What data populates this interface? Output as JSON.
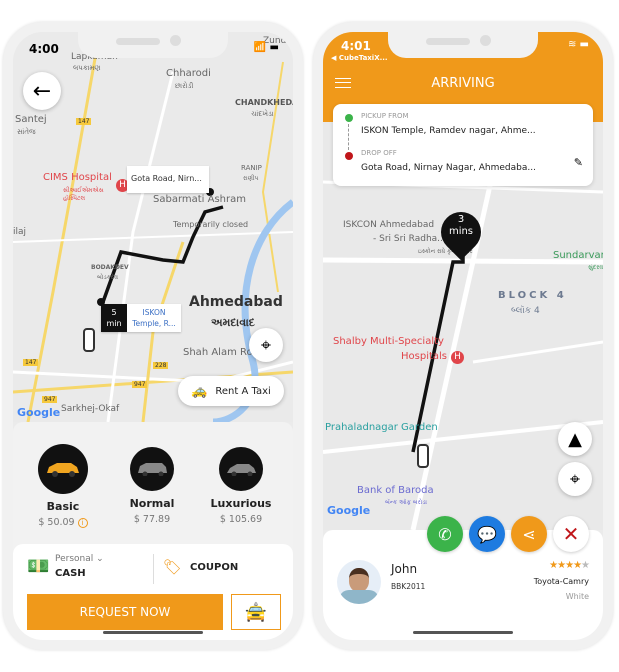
{
  "colors": {
    "accent": "#f0991a",
    "green": "#3bb34a",
    "blue": "#1e7be0",
    "red": "#c0161a"
  },
  "left": {
    "status_time": "4:00",
    "map_labels": {
      "lapkaman": "Lapkaman",
      "lapkaman_gu": "લપકામણ",
      "chharodi": "Chharodi",
      "chharodi_gu": "છારોડી",
      "chandkheda": "CHANDKHEDA",
      "chandkheda_gu": "ચાંદખેડા",
      "santej": "Santej",
      "santej_gu": "સાંતેજ",
      "zundal": "Zundal",
      "cims": "CIMS Hospital",
      "cims_gu": "સીઆઈએમએસ હૉસ્પિટલ",
      "ranip": "RANIP",
      "ranip_gu": "રાણીપ",
      "sabarmati": "Sabarmati Ashram",
      "temp_closed": "Temporarily closed",
      "bodakdev": "BODAKDEV",
      "bodakdev_gu": "બોડકદેવ",
      "ilaj": "ilaj",
      "ahmedabad": "Ahmedabad",
      "ahmedabad_gu": "અમદાવાદ",
      "shah_alam": "Shah Alam Roza",
      "sarkhej": "Sarkhej-Okaf",
      "r147a": "147",
      "r147b": "147",
      "r228": "228",
      "r947a": "947",
      "r947b": "947",
      "google": "Google"
    },
    "drop_tooltip": "Gota Road, Nirn...",
    "eta_value": "5",
    "eta_unit": "min",
    "pickup_tooltip": "ISKON Temple, R...",
    "rent_taxi": "Rent A Taxi",
    "vehicles": [
      {
        "name": "Basic",
        "price": "$ 50.09",
        "selected": true
      },
      {
        "name": "Normal",
        "price": "$ 77.89"
      },
      {
        "name": "Luxurious",
        "price": "$ 105.69"
      }
    ],
    "payment": {
      "type": "Personal",
      "method": "CASH"
    },
    "coupon": "COUPON",
    "request": "REQUEST NOW"
  },
  "right": {
    "status_time": "4:01",
    "back_app": "◀ CubeTaxiX...",
    "title": "ARRIVING",
    "pickup_label": "PICKUP FROM",
    "pickup": "ISKON Temple, Ramdev nagar, Ahme...",
    "drop_label": "DROP OFF",
    "drop": "Gota Road, Nirnay Nagar, Ahmedaba...",
    "eta_value": "3",
    "eta_unit": "mins",
    "map_labels": {
      "iskcon": "ISKCON Ahmedabad",
      "iskcon2": "- Sri Sri Radha...",
      "iskcon_gu": "ઇસ્કોન રાધે કૃષ્ણ મંદિર",
      "sundarvan": "Sundarvan",
      "sundarvan_gu": "સુંદરવ",
      "block4": "BLOCK 4",
      "block4_gu": "બ્લૉક 4",
      "shalby": "Shalby Multi-Specialty",
      "shalby2": "Hospitals",
      "prahlad": "Prahaladnagar Garden",
      "bob": "Bank of Baroda",
      "bob_gu": "બૅન્ક ઑફ બરોડા",
      "google": "Google"
    },
    "driver": {
      "name": "John",
      "plate": "BBK2011",
      "rating": 4,
      "max_rating": 5,
      "car": "Toyota-Camry",
      "color": "White"
    }
  }
}
